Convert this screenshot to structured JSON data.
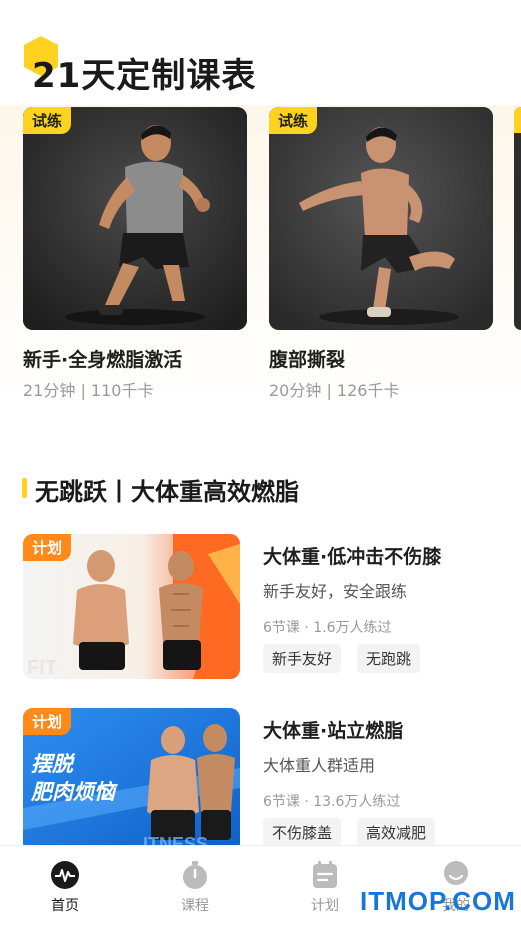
{
  "featured": {
    "title": "21天定制课表",
    "courses": [
      {
        "tag": "试练",
        "name": "新手·全身燃脂激活",
        "meta": "21分钟 | 110千卡"
      },
      {
        "tag": "试练",
        "name": "腹部撕裂",
        "meta": "20分钟 | 126千卡"
      }
    ]
  },
  "section2": {
    "title": "无跳跃丨大体重高效燃脂",
    "plans": [
      {
        "tag": "计划",
        "title": "大体重·低冲击不伤膝",
        "subtitle": "新手友好，安全跟练",
        "stats": "6节课 · 1.6万人练过",
        "chips": [
          "新手友好",
          "无跑跳"
        ]
      },
      {
        "tag": "计划",
        "title": "大体重·站立燃脂",
        "subtitle": "大体重人群适用",
        "stats": "6节课 · 13.6万人练过",
        "chips": [
          "不伤膝盖",
          "高效减肥"
        ],
        "banner_line1": "摆脱",
        "banner_line2": "肥肉烦恼"
      }
    ]
  },
  "tabbar": {
    "items": [
      {
        "label": "首页",
        "icon": "pulse-icon"
      },
      {
        "label": "课程",
        "icon": "stopwatch-icon"
      },
      {
        "label": "计划",
        "icon": "calendar-icon"
      },
      {
        "label": "我的",
        "icon": "profile-icon"
      }
    ]
  },
  "watermark": "ITMOP.COM",
  "colors": {
    "accent": "#ffd21f",
    "plan_tag": "#ff8a1a",
    "active_tab": "#1a1a1a",
    "inactive_tab": "#bbbbbb"
  }
}
